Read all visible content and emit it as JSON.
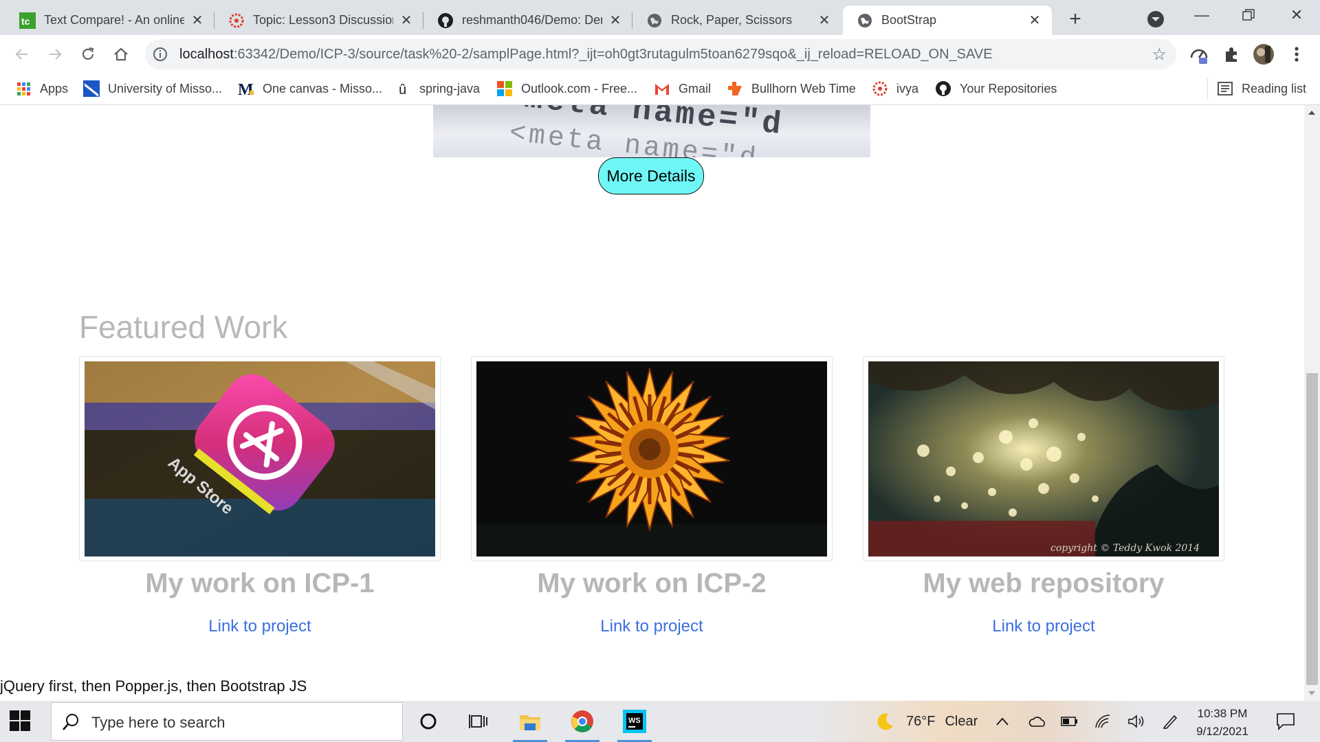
{
  "browser": {
    "tabs": [
      {
        "title": "Text Compare! - An online",
        "icon": "text-compare-icon"
      },
      {
        "title": "Topic: Lesson3 Discussion",
        "icon": "canvas-icon"
      },
      {
        "title": "reshmanth046/Demo: Der",
        "icon": "github-icon"
      },
      {
        "title": "Rock, Paper, Scissors",
        "icon": "globe-icon"
      },
      {
        "title": "BootStrap",
        "icon": "globe-icon",
        "active": true
      }
    ],
    "url_host": "localhost",
    "url_rest": ":63342/Demo/ICP-3/source/task%20-2/samplPage.html?_ijt=oh0gt3rutagulm5toan6279sqo&_ij_reload=RELOAD_ON_SAVE",
    "bookmarks": [
      {
        "label": "Apps",
        "icon": "apps-grid-icon"
      },
      {
        "label": "University of Misso...",
        "icon": "university-icon"
      },
      {
        "label": "One canvas - Misso...",
        "icon": "mizzou-icon"
      },
      {
        "label": "spring-java",
        "icon": "spring-icon"
      },
      {
        "label": "Outlook.com - Free...",
        "icon": "microsoft-icon"
      },
      {
        "label": "Gmail",
        "icon": "gmail-icon"
      },
      {
        "label": "Bullhorn Web Time",
        "icon": "bullhorn-icon"
      },
      {
        "label": "ivya",
        "icon": "canvas-icon"
      },
      {
        "label": "Your Repositories",
        "icon": "github-icon"
      }
    ],
    "reading_list": "Reading list"
  },
  "page": {
    "more_details": "More Details",
    "featured_heading": "Featured Work",
    "cards": [
      {
        "title": "My work on ICP-1",
        "link": "Link to project",
        "image": "app-store-image"
      },
      {
        "title": "My work on ICP-2",
        "link": "Link to project",
        "image": "sunflower-image"
      },
      {
        "title": "My web repository",
        "link": "Link to project",
        "image": "bokeh-image",
        "watermark": "copyright © Teddy Kwok 2014"
      }
    ],
    "hero_code_text": "<meta name=\"d",
    "script_note": "jQuery first, then Popper.js, then Bootstrap JS"
  },
  "taskbar": {
    "search_placeholder": "Type here to search",
    "weather_temp": "76°F",
    "weather_desc": "Clear",
    "time": "10:38 PM",
    "date": "9/12/2021"
  },
  "colors": {
    "button_bg": "#6ff7f7",
    "link": "#3b6fe0",
    "heading_gray": "#b8b8b8"
  }
}
